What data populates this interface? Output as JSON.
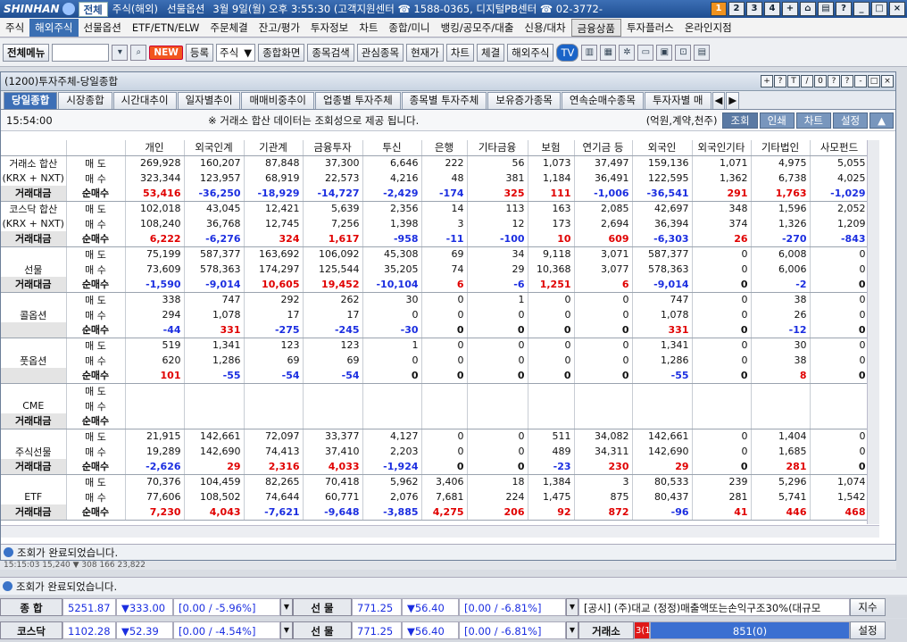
{
  "app": {
    "brand": "SHINHAN",
    "tabs": [
      "전체",
      "주식(해외)",
      "선물옵션"
    ],
    "info": "3월 9일(월) 오후 3:55:30 (고객지원센터 ☎ 1588-0365, 디지털PB센터 ☎ 02-3772-"
  },
  "window_buttons": [
    "1",
    "2",
    "3",
    "4",
    "+"
  ],
  "menu": [
    "주식",
    "해외주식",
    "선물옵션",
    "ETF/ETN/ELW",
    "주문체결",
    "잔고/평가",
    "투자정보",
    "차트",
    "종합/미니",
    "뱅킹/공모주/대출",
    "신용/대차",
    "금융상품",
    "투자플러스",
    "온라인지점"
  ],
  "toolbar": {
    "all_menu": "전체메뉴",
    "new": "NEW",
    "register": "등록",
    "stock_select": "주식",
    "b1": "종합화면",
    "b2": "종목검색",
    "b3": "관심종목",
    "b4": "현재가",
    "b5": "차트",
    "b6": "체결",
    "overseas": "해외주식",
    "tv": "TV"
  },
  "subwindow": {
    "title": "(1200)투자주체-당일종합",
    "controls": [
      "+",
      "?",
      "T",
      "/",
      "0",
      "?",
      "?",
      "-",
      "□",
      "×"
    ]
  },
  "tabs": [
    "당일종합",
    "시장종합",
    "시간대추이",
    "일자별추이",
    "매매비중추이",
    "업종별 투자주체",
    "종목별 투자주체",
    "보유증가종목",
    "연속순매수종목",
    "투자자별 매"
  ],
  "infobar": {
    "time": "15:54:00",
    "notice": "※ 거래소 합산 데이터는 조회성으로 제공 됩니다.",
    "unit": "(억원,계약,천주)",
    "btn1": "조회",
    "btn2": "인쇄",
    "btn3": "차트",
    "btn4": "설정"
  },
  "columns": [
    "개인",
    "외국인계",
    "기관계",
    "금융투자",
    "투신",
    "은행",
    "기타금융",
    "보험",
    "연기금 등",
    "외국인",
    "외국인기타",
    "기타법인",
    "사모펀드"
  ],
  "groups": [
    {
      "name": [
        "거래소 합산",
        "(KRX + NXT)",
        "거래대금"
      ],
      "rows": [
        [
          "매 도",
          [
            "269,928",
            "160,207",
            "87,848",
            "37,300",
            "6,646",
            "222",
            "56",
            "1,073",
            "37,497",
            "159,136",
            "1,071",
            "4,975",
            "5,055"
          ]
        ],
        [
          "매 수",
          [
            "323,344",
            "123,957",
            "68,919",
            "22,573",
            "4,216",
            "48",
            "381",
            "1,184",
            "36,491",
            "122,595",
            "1,362",
            "6,738",
            "4,025"
          ]
        ],
        [
          "순매수",
          [
            "53,416",
            "-36,250",
            "-18,929",
            "-14,727",
            "-2,429",
            "-174",
            "325",
            "111",
            "-1,006",
            "-36,541",
            "291",
            "1,763",
            "-1,029"
          ]
        ]
      ]
    },
    {
      "name": [
        "코스닥 합산",
        "(KRX + NXT)",
        "거래대금"
      ],
      "rows": [
        [
          "매 도",
          [
            "102,018",
            "43,045",
            "12,421",
            "5,639",
            "2,356",
            "14",
            "113",
            "163",
            "2,085",
            "42,697",
            "348",
            "1,596",
            "2,052"
          ]
        ],
        [
          "매 수",
          [
            "108,240",
            "36,768",
            "12,745",
            "7,256",
            "1,398",
            "3",
            "12",
            "173",
            "2,694",
            "36,394",
            "374",
            "1,326",
            "1,209"
          ]
        ],
        [
          "순매수",
          [
            "6,222",
            "-6,276",
            "324",
            "1,617",
            "-958",
            "-11",
            "-100",
            "10",
            "609",
            "-6,303",
            "26",
            "-270",
            "-843"
          ]
        ]
      ]
    },
    {
      "name": [
        "",
        "선물",
        "거래대금"
      ],
      "rows": [
        [
          "매 도",
          [
            "75,199",
            "587,377",
            "163,692",
            "106,092",
            "45,308",
            "69",
            "34",
            "9,118",
            "3,071",
            "587,377",
            "0",
            "6,008",
            "0"
          ]
        ],
        [
          "매 수",
          [
            "73,609",
            "578,363",
            "174,297",
            "125,544",
            "35,205",
            "74",
            "29",
            "10,368",
            "3,077",
            "578,363",
            "0",
            "6,006",
            "0"
          ]
        ],
        [
          "순매수",
          [
            "-1,590",
            "-9,014",
            "10,605",
            "19,452",
            "-10,104",
            "6",
            "-6",
            "1,251",
            "6",
            "-9,014",
            "0",
            "-2",
            "0"
          ]
        ]
      ]
    },
    {
      "name": [
        "",
        "콜옵션",
        ""
      ],
      "rows": [
        [
          "매 도",
          [
            "338",
            "747",
            "292",
            "262",
            "30",
            "0",
            "1",
            "0",
            "0",
            "747",
            "0",
            "38",
            "0"
          ]
        ],
        [
          "매 수",
          [
            "294",
            "1,078",
            "17",
            "17",
            "0",
            "0",
            "0",
            "0",
            "0",
            "1,078",
            "0",
            "26",
            "0"
          ]
        ],
        [
          "순매수",
          [
            "-44",
            "331",
            "-275",
            "-245",
            "-30",
            "0",
            "0",
            "0",
            "0",
            "331",
            "0",
            "-12",
            "0"
          ]
        ]
      ]
    },
    {
      "name": [
        "",
        "풋옵션",
        ""
      ],
      "rows": [
        [
          "매 도",
          [
            "519",
            "1,341",
            "123",
            "123",
            "1",
            "0",
            "0",
            "0",
            "0",
            "1,341",
            "0",
            "30",
            "0"
          ]
        ],
        [
          "매 수",
          [
            "620",
            "1,286",
            "69",
            "69",
            "0",
            "0",
            "0",
            "0",
            "0",
            "1,286",
            "0",
            "38",
            "0"
          ]
        ],
        [
          "순매수",
          [
            "101",
            "-55",
            "-54",
            "-54",
            "0",
            "0",
            "0",
            "0",
            "0",
            "-55",
            "0",
            "8",
            "0"
          ]
        ]
      ]
    },
    {
      "name": [
        "",
        "CME",
        "거래대금"
      ],
      "rows": [
        [
          "매 도",
          [
            "",
            "",
            "",
            "",
            "",
            "",
            "",
            "",
            "",
            "",
            "",
            "",
            ""
          ]
        ],
        [
          "매 수",
          [
            "",
            "",
            "",
            "",
            "",
            "",
            "",
            "",
            "",
            "",
            "",
            "",
            ""
          ]
        ],
        [
          "순매수",
          [
            "",
            "",
            "",
            "",
            "",
            "",
            "",
            "",
            "",
            "",
            "",
            "",
            ""
          ]
        ]
      ]
    },
    {
      "name": [
        "",
        "주식선물",
        "거래대금"
      ],
      "rows": [
        [
          "매 도",
          [
            "21,915",
            "142,661",
            "72,097",
            "33,377",
            "4,127",
            "0",
            "0",
            "511",
            "34,082",
            "142,661",
            "0",
            "1,404",
            "0"
          ]
        ],
        [
          "매 수",
          [
            "19,289",
            "142,690",
            "74,413",
            "37,410",
            "2,203",
            "0",
            "0",
            "489",
            "34,311",
            "142,690",
            "0",
            "1,685",
            "0"
          ]
        ],
        [
          "순매수",
          [
            "-2,626",
            "29",
            "2,316",
            "4,033",
            "-1,924",
            "0",
            "0",
            "-23",
            "230",
            "29",
            "0",
            "281",
            "0"
          ]
        ]
      ]
    },
    {
      "name": [
        "",
        "ETF",
        "거래대금"
      ],
      "rows": [
        [
          "매 도",
          [
            "70,376",
            "104,459",
            "82,265",
            "70,418",
            "5,962",
            "3,406",
            "18",
            "1,384",
            "3",
            "80,533",
            "239",
            "5,296",
            "1,074"
          ]
        ],
        [
          "매 수",
          [
            "77,606",
            "108,502",
            "74,644",
            "60,771",
            "2,076",
            "7,681",
            "224",
            "1,475",
            "875",
            "80,437",
            "281",
            "5,741",
            "1,542"
          ]
        ],
        [
          "순매수",
          [
            "7,230",
            "4,043",
            "-7,621",
            "-9,648",
            "-3,885",
            "4,275",
            "206",
            "92",
            "872",
            "-96",
            "41",
            "446",
            "468"
          ]
        ]
      ]
    }
  ],
  "status1": "조회가 완료되었습니다.",
  "bg_row": "15:15:03      15,240 ▼      308          166              23,822",
  "status2": "조회가 완료되었습니다.",
  "bottom1": {
    "l1": "종  합",
    "v1": "5251.87",
    "c1": "▼333.00",
    "p1": "[0.00 / -5.96%]",
    "l2": "선  물",
    "v2": "771.25",
    "c2": "▼56.40",
    "p2": "[0.00 / -6.81%]",
    "news": "[공시] (주)대교 (정정)매출액또는손익구조30%(대규모",
    "btn": "지수"
  },
  "bottom2": {
    "l1": "코스닥",
    "v1": "1102.28",
    "c1": "▼52.39",
    "p1": "[0.00 / -4.54%]",
    "l2": "선  물",
    "v2": "771.25",
    "c2": "▼56.40",
    "p2": "[0.00 / -6.81%]",
    "exch": "거래소",
    "prog_a": "3(1",
    "prog_b": "851(0)",
    "btn": "설정"
  }
}
